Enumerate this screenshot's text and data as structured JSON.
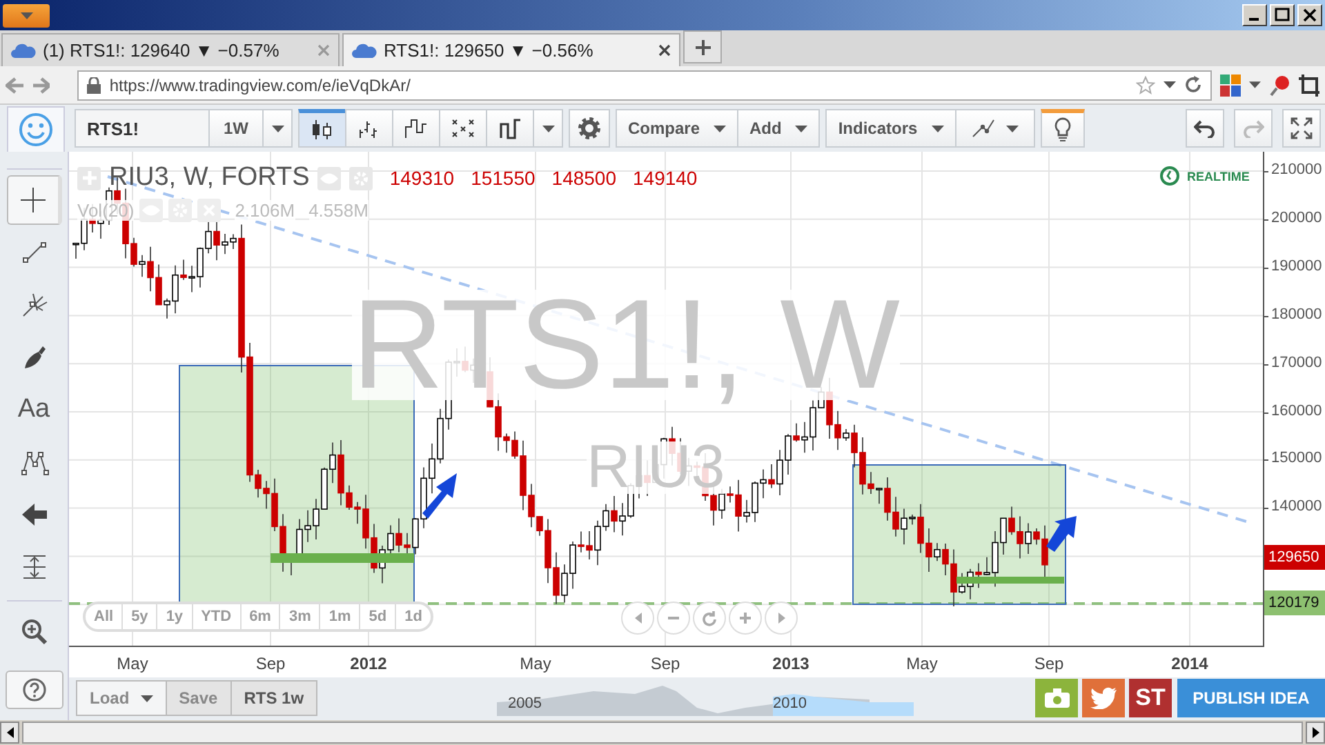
{
  "tabs": [
    {
      "label": "(1) RTS1!: 129640 ▼ −0.57%",
      "selected": false
    },
    {
      "label": "RTS1!: 129650 ▼ −0.56%",
      "selected": true
    }
  ],
  "address_bar": {
    "value": "https://www.tradingview.com/e/ieVqDkAr/"
  },
  "toolbar": {
    "symbol": "RTS1!",
    "interval": "1W",
    "chart_styles": [
      {
        "kind": "candles",
        "selected": true
      },
      {
        "kind": "bars",
        "selected": false
      },
      {
        "kind": "line-break",
        "selected": false
      },
      {
        "kind": "point-figure",
        "selected": false
      },
      {
        "kind": "kagi",
        "selected": false
      }
    ],
    "menus": [
      "Compare",
      "Add",
      "Indicators"
    ],
    "hints_on": true
  },
  "drawing_tools": [
    {
      "kind": "crosshair",
      "selected": true
    },
    {
      "kind": "line",
      "selected": false
    },
    {
      "kind": "pitchfork",
      "selected": false
    },
    {
      "kind": "brush",
      "selected": false
    },
    {
      "kind": "text",
      "label": "Aa",
      "selected": false
    },
    {
      "kind": "pattern",
      "selected": false
    },
    {
      "kind": "arrow",
      "selected": false
    },
    {
      "kind": "measure",
      "selected": false
    },
    {
      "kind": "zoom",
      "selected": false
    }
  ],
  "legend": {
    "title": "RIU3, W, FORTS",
    "values": [
      "149310",
      "151550",
      "148500",
      "149140"
    ]
  },
  "volume": {
    "label": "Vol(20)",
    "values": [
      "2.106M",
      "4.558M"
    ]
  },
  "watermark": {
    "symbol": "RTS1!, W",
    "description": "RIU3"
  },
  "realtime": "REALTIME",
  "price_axis": {
    "ticks": [
      "210000",
      "200000",
      "190000",
      "180000",
      "170000",
      "160000",
      "150000",
      "140000"
    ],
    "last_price": "129650",
    "line_price": "120179"
  },
  "time_axis": [
    {
      "label": "May",
      "bold": false
    },
    {
      "label": "Sep",
      "bold": false
    },
    {
      "label": "2012",
      "bold": true
    },
    {
      "label": "May",
      "bold": false
    },
    {
      "label": "Sep",
      "bold": false
    },
    {
      "label": "2013",
      "bold": true
    },
    {
      "label": "May",
      "bold": false
    },
    {
      "label": "Sep",
      "bold": false
    },
    {
      "label": "2014",
      "bold": true
    }
  ],
  "ranges": [
    "All",
    "5y",
    "1y",
    "YTD",
    "6m",
    "3m",
    "1m",
    "5d",
    "1d"
  ],
  "bottom": {
    "load": "Load",
    "save": "Save",
    "layout": "RTS 1w",
    "navigator": [
      "2005",
      "2010"
    ],
    "share": [
      {
        "kind": "camera"
      },
      {
        "kind": "twitter"
      },
      {
        "kind": "stocktwits",
        "label": "ST"
      }
    ],
    "publish": "PUBLISH IDEA"
  }
}
